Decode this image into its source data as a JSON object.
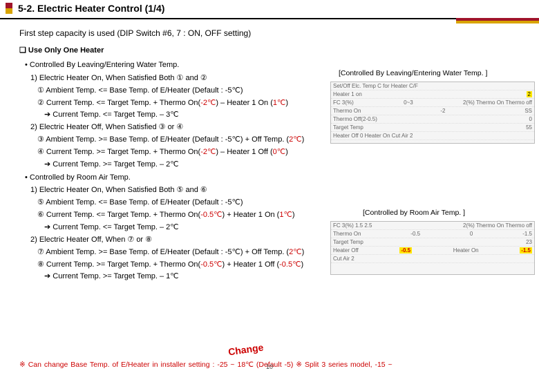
{
  "title": "5-2. Electric Heater Control (1/4)",
  "intro": "First step capacity is used (DIP Switch #6, 7 : ON, OFF setting)",
  "section_heading": "❏ Use Only One Heater",
  "groupA": {
    "heading": "• Controlled By Leaving/Entering Water Temp.",
    "caption": "[Controlled By Leaving/Entering Water Temp. ]",
    "on_line": "1) Electric Heater On, When Satisfied Both ① and ②",
    "cond1": "① Ambient Temp. <= Base Temp. of E/Heater (Default : -5℃)",
    "cond2_pre": "② Current Temp. <= Target Temp. + Thermo On(",
    "cond2_a": "-2℃",
    "cond2_mid": ") – Heater 1 On (",
    "cond2_b": "1℃",
    "cond2_post": ")",
    "arrow_on": "➔ Current Temp. <= Target Temp. – 3℃",
    "off_line": "2) Electric Heater Off, When Satisfied ③ or ④",
    "cond3_pre": "③ Ambient Temp. >= Base Temp. of E/Heater (Default : -5℃) + Off Temp. (",
    "cond3_a": "2℃",
    "cond3_post": ")",
    "cond4_pre": "④ Current Temp. >= Target Temp. + Thermo On(",
    "cond4_a": "-2℃",
    "cond4_mid": ") – Heater 1 Off (",
    "cond4_b": "0℃",
    "cond4_post": ")",
    "arrow_off": "➔ Current Temp. >= Target Temp. – 2℃"
  },
  "groupB": {
    "heading": "• Controlled by Room Air Temp.",
    "caption": "[Controlled by Room Air Temp. ]",
    "on_line": "1) Electric Heater On, When Satisfied Both ⑤ and ⑥",
    "cond5": "⑤ Ambient Temp. <= Base Temp. of E/Heater (Default : -5℃)",
    "cond6_pre": "⑥ Current Temp. <= Target Temp. + Thermo On(",
    "cond6_a": "-0.5℃",
    "cond6_mid": ") + Heater 1 On (",
    "cond6_b": "1℃",
    "cond6_post": ")",
    "arrow_on": "➔ Current Temp. <= Target Temp. – 2℃",
    "off_line": "2) Electric Heater Off, When ⑦ or ⑧",
    "cond7_pre": "⑦ Ambient Temp. >= Base Temp. of E/Heater (Default : -5℃) + Off Temp. (",
    "cond7_a": "2℃",
    "cond7_post": ")",
    "cond8_pre": "⑧ Current Temp. >= Target Temp. + Thermo On(",
    "cond8_a": "-0.5℃",
    "cond8_mid": ") + Heater 1 Off (",
    "cond8_b": "-0.5℃",
    "cond8_post": ")",
    "arrow_off": "➔ Current Temp. >= Target Temp. – 1℃"
  },
  "change_label": "Change",
  "footnote": "※ Can change Base Temp. of E/Heater in installer setting : -25 ~ 18℃ (Default -5) ※ Split 3 series model, -15 ~ ",
  "page_number": "10",
  "plot1": {
    "r1": "Set/Off Elc. Temp     C     for Heater  C/F",
    "r2": "Heater 1 on",
    "v2": "2",
    "r3": "FC 3(%)",
    "v3a": "0~3",
    "v3b": "2(%)   Thermo On   Thermo off",
    "r4": "Thermo On",
    "v4a": "-2",
    "v4b": "SS",
    "r5": "Thermo Off(2-0.5)",
    "v5": "0",
    "r6": "Target Temp",
    "v6": "55",
    "r7": "Heater Off     0     Heater On   Cut Air   2"
  },
  "plot2": {
    "r1": "FC 3(%)     1.5   2.5",
    "v1b": "2(%)   Thermo On   Thermo off",
    "r2": "Thermo On",
    "v2a": "-0.5",
    "v2b": "0",
    "v2c": "-1.5",
    "r3": "Target Temp",
    "v3": "23",
    "r4": "Heater Off",
    "v4a": "-0.5",
    "v4b": "Heater On",
    "v4c": "-1.5",
    "r5": "Cut Air   2"
  }
}
